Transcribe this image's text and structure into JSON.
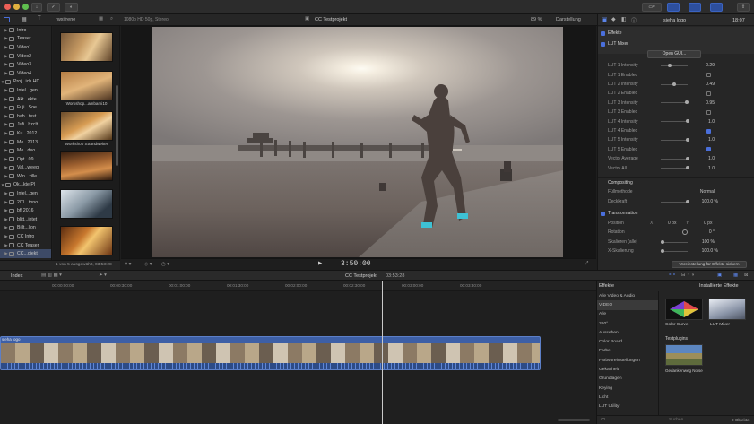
{
  "colors": {
    "accent": "#4a6fdb",
    "clip": "#3d5fa6",
    "playhead": "#c9c9c9"
  },
  "toolbar": {
    "library_filter": "Hidden",
    "browser_info": "1080p HD 50p, Stereo",
    "project_title": "CC Testprojekt",
    "zoom": "89 %",
    "view_menu": "Darstellung",
    "inspector_title": "sieha logo",
    "inspector_time": "18:07"
  },
  "library": {
    "items": [
      {
        "label": "Intro",
        "depth": 1,
        "selected": false
      },
      {
        "label": "Teaser",
        "depth": 1,
        "selected": false
      },
      {
        "label": "Video1",
        "depth": 1,
        "selected": false
      },
      {
        "label": "Video2",
        "depth": 1,
        "selected": false
      },
      {
        "label": "Video3",
        "depth": 1,
        "selected": false
      },
      {
        "label": "Video4",
        "depth": 1,
        "selected": false
      },
      {
        "label": "Proj...ich HD",
        "depth": 0,
        "selected": false
      },
      {
        "label": "Intel...gen",
        "depth": 1,
        "selected": false
      },
      {
        "label": "Akt...ekte",
        "depth": 1,
        "selected": false
      },
      {
        "label": "Fuji...Soe",
        "depth": 1,
        "selected": false
      },
      {
        "label": "hab...test",
        "depth": 1,
        "selected": false
      },
      {
        "label": "Jufi...hzclt",
        "depth": 1,
        "selected": false
      },
      {
        "label": "Ku...2012",
        "depth": 1,
        "selected": false
      },
      {
        "label": "Mo...2013",
        "depth": 1,
        "selected": false
      },
      {
        "label": "Mo...deo",
        "depth": 1,
        "selected": false
      },
      {
        "label": "Opt...09",
        "depth": 1,
        "selected": false
      },
      {
        "label": "Val...weeg",
        "depth": 1,
        "selected": false
      },
      {
        "label": "Win...zille",
        "depth": 1,
        "selected": false
      },
      {
        "label": "Ok...kte Pl",
        "depth": 0,
        "selected": false
      },
      {
        "label": "Intel...gen",
        "depth": 1,
        "selected": false
      },
      {
        "label": "201...tono",
        "depth": 1,
        "selected": false
      },
      {
        "label": "bfl 2016",
        "depth": 1,
        "selected": false
      },
      {
        "label": "blitt...intet",
        "depth": 1,
        "selected": false
      },
      {
        "label": "Billt...lion",
        "depth": 1,
        "selected": false
      },
      {
        "label": "CC Intro",
        "depth": 1,
        "selected": false
      },
      {
        "label": "CC Teaser",
        "depth": 1,
        "selected": false
      },
      {
        "label": "CC...ojekt",
        "depth": 1,
        "selected": true
      }
    ]
  },
  "browser": {
    "title": "rwxifrene",
    "clip_labels": [
      "Workshop...ambami10",
      "Workshop Strandweiter"
    ],
    "status": "1 von 5 ausgewählt, 03:53:28"
  },
  "viewer": {
    "timecode": "3:50:00",
    "zoom_label": "89 %"
  },
  "inspector": {
    "effects_header": "Effekte",
    "lut_header": "LUT Mixer",
    "open_gui_button": "Open GUI...",
    "params": [
      {
        "label": "LUT 1 Intensity",
        "value": "0.29",
        "kind": "slider",
        "pos": 0.3
      },
      {
        "label": "LUT 1 Enabled",
        "value": "",
        "kind": "check",
        "on": false
      },
      {
        "label": "LUT 2 Intensity",
        "value": "0.49",
        "kind": "slider",
        "pos": 0.45
      },
      {
        "label": "LUT 2 Enabled",
        "value": "",
        "kind": "check",
        "on": false
      },
      {
        "label": "LUT 3 Intensity",
        "value": "0.95",
        "kind": "slider",
        "pos": 0.95
      },
      {
        "label": "LUT 3 Enabled",
        "value": "",
        "kind": "check",
        "on": false
      },
      {
        "label": "LUT 4 Intensity",
        "value": "1.0",
        "kind": "slider",
        "pos": 1.0
      },
      {
        "label": "LUT 4 Enabled",
        "value": "",
        "kind": "check",
        "on": true
      },
      {
        "label": "LUT 5 Intensity",
        "value": "1.0",
        "kind": "slider",
        "pos": 1.0
      },
      {
        "label": "LUT 5 Enabled",
        "value": "",
        "kind": "check",
        "on": true
      },
      {
        "label": "Vector Average",
        "value": "1.0",
        "kind": "slider",
        "pos": 1.0
      },
      {
        "label": "Vector All",
        "value": "1.0",
        "kind": "slider",
        "pos": 1.0
      }
    ],
    "compositing_header": "Compositing",
    "blend_label": "Füllmethode",
    "blend_value": "Normal",
    "opacity_label": "Deckkraft",
    "opacity_value": "100.0 %",
    "transform_header": "Transformation",
    "position_label": "Position",
    "position_x": "0 px",
    "position_y": "0 px",
    "rotation_label": "Rotation",
    "rotation_value": "0 °",
    "scale_all_label": "Skalieren (alle)",
    "scale_all_value": "100 %",
    "scale_x_label": "X-Skalierung",
    "scale_x_value": "100.0 %",
    "save_preset_button": "Voreinstellung für Effekte sichern"
  },
  "timeline": {
    "index_label": "Index",
    "project_label": "CC Testprojekt",
    "project_time": "03:53:28",
    "ruler": [
      "00:00:00:00",
      "00:00:30:00",
      "00:01:00:00",
      "00:01:30:00",
      "00:02:00:00",
      "00:02:30:00",
      "00:03:00:00",
      "00:03:30:00"
    ],
    "clip_name": "sieha logo"
  },
  "effects_browser": {
    "title": "Effekte",
    "right_title": "Installierte Effekte",
    "categories": [
      "Alle Video & Audio",
      "VIDEO",
      "Alle",
      "360°",
      "Aussehen",
      "Color Board",
      "Farbe",
      "Farbvoreinstellungen",
      "Gekachelt",
      "Grundlagen",
      "Keying",
      "Licht",
      "LUT Utility"
    ],
    "selected_category": "VIDEO",
    "items": [
      "Color Curve",
      "LUT Mixer"
    ],
    "plugins_header": "Testplugins",
    "plugin_item": "Gedankenweg Noise",
    "count": "2 Objekte",
    "search_placeholder": "Suchen"
  }
}
